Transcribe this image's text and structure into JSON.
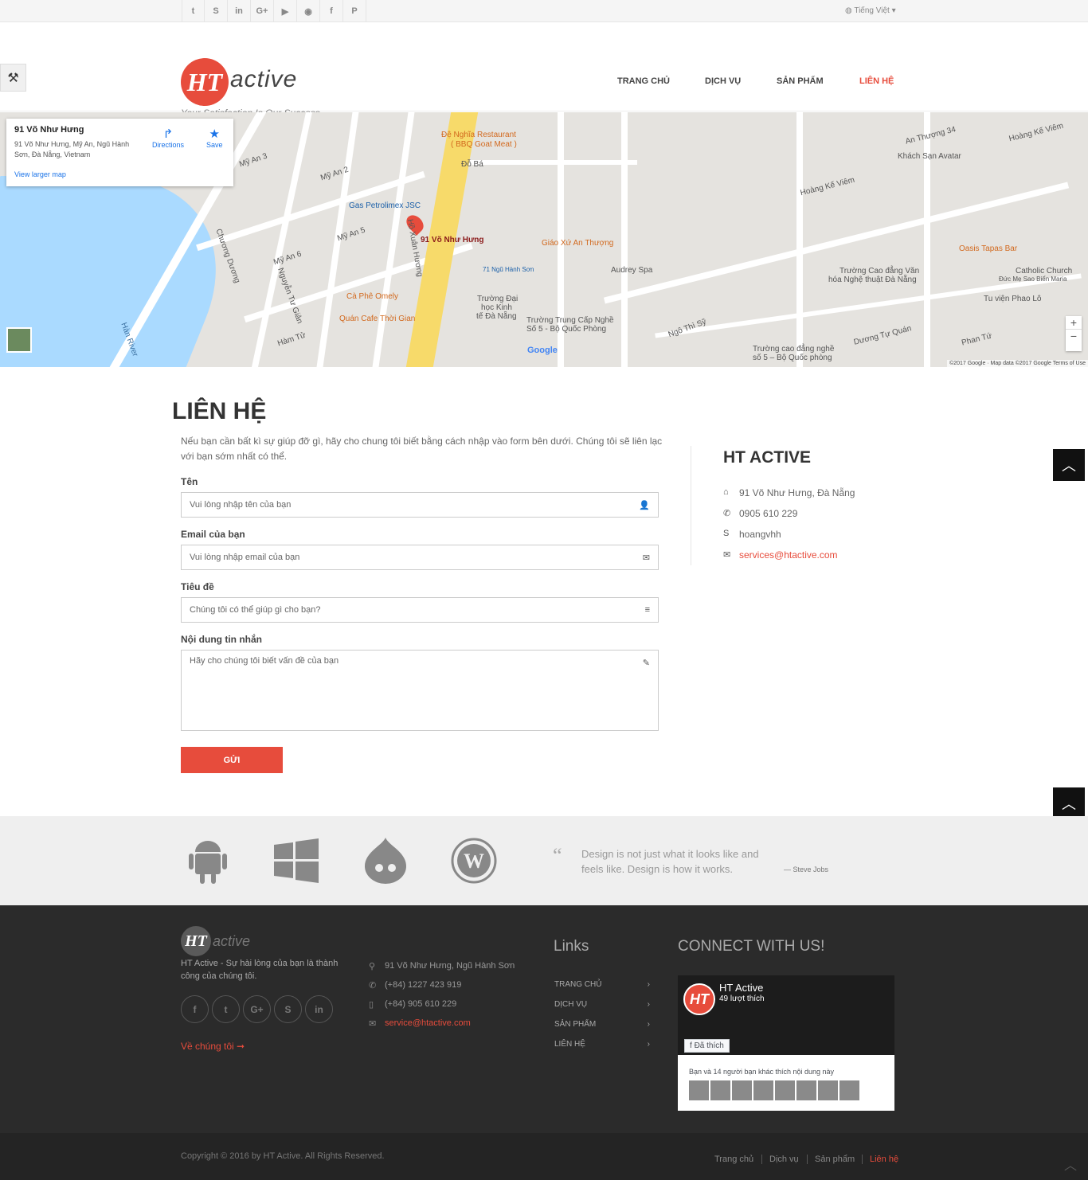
{
  "topbar": {
    "social": [
      "t",
      "S",
      "in",
      "G+",
      "▶",
      "◉",
      "f",
      "P"
    ],
    "language": "Tiếng Việt ▾"
  },
  "header": {
    "logo_mark": "HT",
    "logo_word": "active",
    "tagline": "Your Satisfaction Is Our Success",
    "nav": [
      "TRANG CHỦ",
      "DỊCH VỤ",
      "SẢN PHẨM",
      "LIÊN HỆ"
    ]
  },
  "map": {
    "info_title": "91 Võ Như Hưng",
    "info_address": "91 Võ Như Hưng, Mỹ An, Ngũ Hành Sơn, Đà Nẵng, Vietnam",
    "directions": "Directions",
    "save": "Save",
    "view_larger": "View larger map",
    "pin_label": "91 Võ Như Hưng",
    "copyright": "©2017 Google · Map data ©2017 Google   Terms of Use",
    "labels": [
      "Đệ Nghĩa Restaurant",
      "( BBQ Goat Meat )",
      "Gas Petrolimex JSC",
      "Giáo Xứ An Thượng",
      "Hoàng Kế Viêm",
      "Audrey Spa",
      "Khách Sạn Avatar",
      "Oasis Tapas Bar",
      "Catholic Church",
      "Đức Mẹ Sao Biển Maria",
      "Trường Cao đẳng Văn",
      "hóa Nghệ thuật Đà Nẵng",
      "Tu viện Phao Lô",
      "Cà Phê Omely",
      "Quán Cafe Thời Gian",
      "Trường Đại",
      "học Kinh",
      "tế Đà Nẵng",
      "Trường Trung Cấp Nghề",
      "Số 5 - Bộ Quốc Phòng",
      "Trường cao đẳng nghề",
      "số 5 – Bộ Quốc phòng",
      "71 Ngũ Hành Sơn",
      "Hàn River",
      "Google",
      "Ngô Thì Sỹ",
      "Dương Tự Quán",
      "Phan Tứ",
      "An Thượng 34",
      "Hoàng Kế Viêm",
      "Đỗ Bá",
      "Mỹ An 2",
      "Mỹ An 3",
      "Mỹ An 5",
      "Mỹ An 6",
      "Hồ Xuân Hương",
      "Nguyễn Tư Giản",
      "Chương Dương",
      "Hàm Tử"
    ]
  },
  "contact": {
    "heading": "LIÊN HỆ",
    "intro": "Nếu bạn cần bất kì sự giúp đỡ gì, hãy cho chung tôi biết bằng cách nhập vào form bên dưới. Chúng tôi sẽ liên lạc với bạn sớm nhất có thể.",
    "name_label": "Tên",
    "name_ph": "Vui lòng nhập tên của bạn",
    "email_label": "Email của bạn",
    "email_ph": "Vui lòng nhập email của bạn",
    "subject_label": "Tiêu đề",
    "subject_ph": "Chúng tôi có thể giúp gì cho bạn?",
    "message_label": "Nội dung tin nhắn",
    "message_ph": "Hãy cho chúng tôi biết vấn đề của bạn",
    "send": "GỬI"
  },
  "company": {
    "heading": "HT ACTIVE",
    "address": "91 Võ Như Hưng, Đà Nẵng",
    "phone": "0905 610 229",
    "skype": "hoangvhh",
    "email": "services@htactive.com"
  },
  "band": {
    "quote": "Design is not just what it looks like and feels like. Design is how it works.",
    "author": "— Steve Jobs",
    "quote_mark": "“"
  },
  "footer": {
    "logo_mark": "HT",
    "logo_word": "active",
    "desc": "HT Active - Sự hài lòng của bạn là thành công của chúng tôi.",
    "social": [
      "f",
      "t",
      "G+",
      "S",
      "in"
    ],
    "about": "Về chúng tôi ➞",
    "address": "91 Võ Như Hưng, Ngũ Hành Sơn",
    "phone1": "(+84) 1227 423 919",
    "phone2": "(+84) 905 610 229",
    "email": "service@htactive.com",
    "links_heading": "Links",
    "links": [
      "TRANG CHỦ",
      "DỊCH VỤ",
      "SẢN PHẨM",
      "LIÊN HỆ"
    ],
    "connect_heading": "CONNECT WITH US!",
    "fb_name": "HT Active",
    "fb_likes": "49 lượt thích",
    "fb_liked": "Đã thích",
    "fb_friends": "Bạn và 14 người bạn khác thích nội dung này"
  },
  "bottom": {
    "copyright": "Copyright © 2016 by HT Active. All Rights Reserved.",
    "nav": [
      "Trang chủ",
      "Dịch vụ",
      "Sản phẩm",
      "Liên hệ"
    ]
  },
  "colors": {
    "accent": "#e74c3c",
    "footer_bg": "#2b2b2b"
  }
}
